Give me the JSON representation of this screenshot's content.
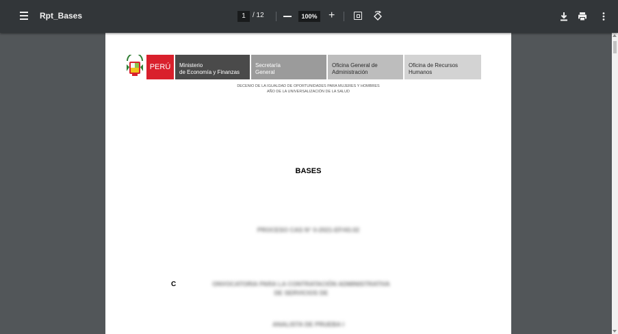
{
  "toolbar": {
    "title": "Rpt_Bases",
    "page_current": "1",
    "page_total": "/ 12",
    "zoom": "100%",
    "plus": "+"
  },
  "document": {
    "logo_text": "PERÚ",
    "orgs": [
      {
        "line1": "Ministerio",
        "line2": "de Economía y Finanzas"
      },
      {
        "line1": "Secretaría",
        "line2": "General"
      },
      {
        "line1": "Oficina General de",
        "line2": "Administración"
      },
      {
        "line1": "Oficina de Recursos",
        "line2": "Humanos"
      }
    ],
    "decenio_line1": "DECENIO DE LA IGUALDAD DE OPORTUNIDADES PARA MUJERES Y HOMBRES",
    "decenio_line2": "AÑO DE LA UNIVERSALIZACIÓN DE LA SALUD",
    "heading": "BASES",
    "proceso_blurred": "PROCESO CAS N° 0-2021-EF/43.02",
    "convocatoria_first_letter": "C",
    "convocatoria_line1_blurred": "ONVOCATORIA PARA LA CONTRATACIÓN ADMINISTRATIVA",
    "convocatoria_line2_blurred": "DE SERVICIOS DE",
    "position_blurred": "ANALISTA DE PRUEBA I"
  }
}
